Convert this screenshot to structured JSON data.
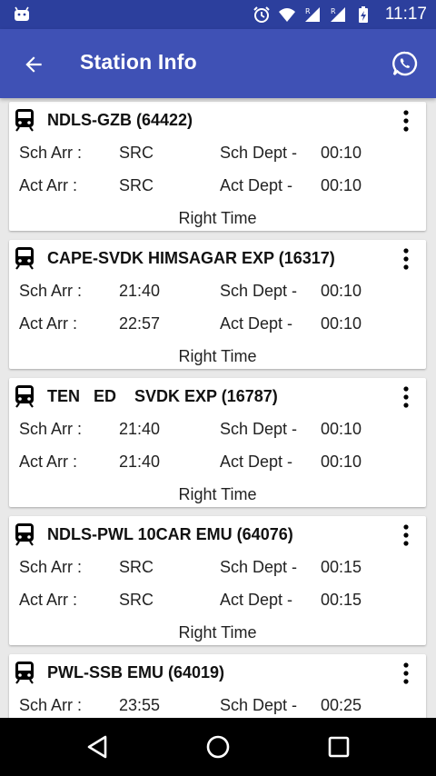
{
  "status_bar": {
    "time": "11:17",
    "icons": [
      "android-notification-icon",
      "alarm-icon",
      "wifi-icon",
      "signal-r-icon",
      "signal-r-icon",
      "battery-charging-icon"
    ]
  },
  "app_bar": {
    "title": "Station Info",
    "back_icon": "arrow-left-icon",
    "share_icon": "whatsapp-icon"
  },
  "labels": {
    "sch_arr": "Sch Arr :",
    "act_arr": "Act Arr :",
    "sch_dept": "Sch Dept -",
    "act_dept": "Act Dept -"
  },
  "trains": [
    {
      "name": "NDLS-GZB (64422)",
      "sch_arr": "SRC",
      "act_arr": "SRC",
      "sch_dept": "00:10",
      "act_dept": "00:10",
      "status": "Right Time"
    },
    {
      "name": "CAPE-SVDK HIMSAGAR EXP (16317)",
      "sch_arr": "21:40",
      "act_arr": "22:57",
      "sch_dept": "00:10",
      "act_dept": "00:10",
      "status": "Right Time"
    },
    {
      "name": "TEN   ED    SVDK EXP (16787)",
      "sch_arr": "21:40",
      "act_arr": "21:40",
      "sch_dept": "00:10",
      "act_dept": "00:10",
      "status": "Right Time"
    },
    {
      "name": "NDLS-PWL 10CAR EMU (64076)",
      "sch_arr": "SRC",
      "act_arr": "SRC",
      "sch_dept": "00:15",
      "act_dept": "00:15",
      "status": "Right Time"
    },
    {
      "name": "PWL-SSB EMU (64019)",
      "sch_arr": "23:55",
      "act_arr": "",
      "sch_dept": "00:25",
      "act_dept": "",
      "status": ""
    }
  ],
  "nav_bar": {
    "back_icon": "nav-back-triangle-icon",
    "home_icon": "nav-home-circle-icon",
    "recents_icon": "nav-recents-square-icon"
  },
  "colors": {
    "status_bar": "#2c3f9d",
    "app_bar": "#3f51b5",
    "background": "#e9e9e9",
    "card": "#ffffff",
    "nav_bar": "#000000"
  }
}
